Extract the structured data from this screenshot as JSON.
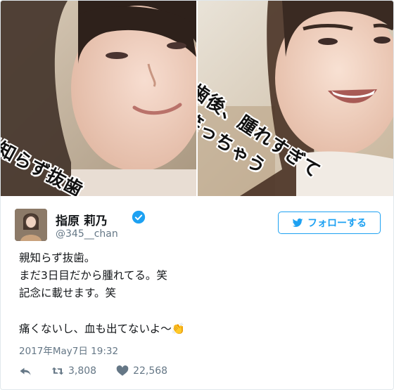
{
  "photos": {
    "left_caption": "親知らず抜歯",
    "right_caption_line1": "歯後、腫れすぎて",
    "right_caption_line2": "笑っちゃう"
  },
  "user": {
    "name": "指原 莉乃",
    "handle": "@345__chan",
    "verified": true
  },
  "follow_button": {
    "label": "フォローする",
    "icon": "twitter-bird-icon"
  },
  "tweet": {
    "lines": [
      "親知らず抜歯。",
      "まだ3日目だから腫れてる。笑",
      "記念に載せます。笑",
      "",
      "痛くないし、血も出てないよ〜👏"
    ],
    "timestamp": "2017年May7日 19:32"
  },
  "stats": {
    "retweets": "3,808",
    "likes": "22,568"
  },
  "colors": {
    "accent": "#1da1f2",
    "muted": "#657786",
    "text": "#14171a"
  }
}
